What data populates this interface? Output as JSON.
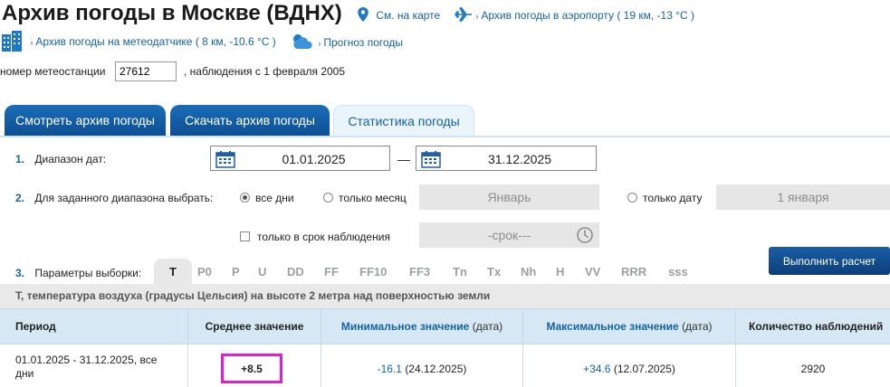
{
  "header": {
    "title": "Архив погоды в Москве (ВДНХ)",
    "map_link": "См. на карте",
    "airport_link": "Архив погоды в аэропорту ( 19 км, -13 °C )",
    "sensor_link": "Архив погоды на метеодатчике ( 8 км, -10.6 °C )",
    "forecast_link": "Прогноз погоды"
  },
  "station": {
    "label": "номер метеостанции",
    "number": "27612",
    "since": ", наблюдения с 1 февраля 2005"
  },
  "tabs": [
    {
      "label": "Смотреть архив погоды",
      "active": false
    },
    {
      "label": "Скачать архив погоды",
      "active": false
    },
    {
      "label": "Статистика погоды",
      "active": true
    }
  ],
  "form": {
    "step1_num": "1.",
    "step1_label": "Диапазон дат:",
    "date_from": "01.01.2025",
    "date_sep": "—",
    "date_to": "31.12.2025",
    "step2_num": "2.",
    "step2_label": "Для заданного диапазона выбрать:",
    "opt_all_days": "все дни",
    "opt_month": "только месяц",
    "month_value": "Январь",
    "opt_date": "только дату",
    "date_value": "1 января",
    "opt_obs_time": "только в срок наблюдения",
    "time_value": "-срок---",
    "step3_num": "3.",
    "step3_label": "Параметры выборки:",
    "run_button": "Выполнить расчет"
  },
  "params": [
    "T",
    "P0",
    "P",
    "U",
    "DD",
    "FF",
    "FF10",
    "FF3",
    "Tn",
    "Tx",
    "Nh",
    "H",
    "VV",
    "RRR",
    "sss"
  ],
  "selected_param_description": "T, температура воздуха (градусы Цельсия) на высоте 2 метра над поверхностью земли",
  "table": {
    "headers": {
      "period": "Период",
      "mean": "Среднее значение",
      "min": "Минимальное значение",
      "min_suffix": "(дата)",
      "max": "Максимальное значение",
      "max_suffix": "(дата)",
      "count": "Количество наблюдений"
    },
    "row": {
      "period": "01.01.2025 - 31.12.2025, все дни",
      "mean": "+8.5",
      "min_value": "-16.1",
      "min_date": "(24.12.2025)",
      "max_value": "+34.6",
      "max_date": "(12.07.2025)",
      "count": "2920"
    }
  },
  "colors": {
    "accent": "#1462a8",
    "highlight": "#e41bd5",
    "table_header_bg": "#d7e8f5"
  }
}
